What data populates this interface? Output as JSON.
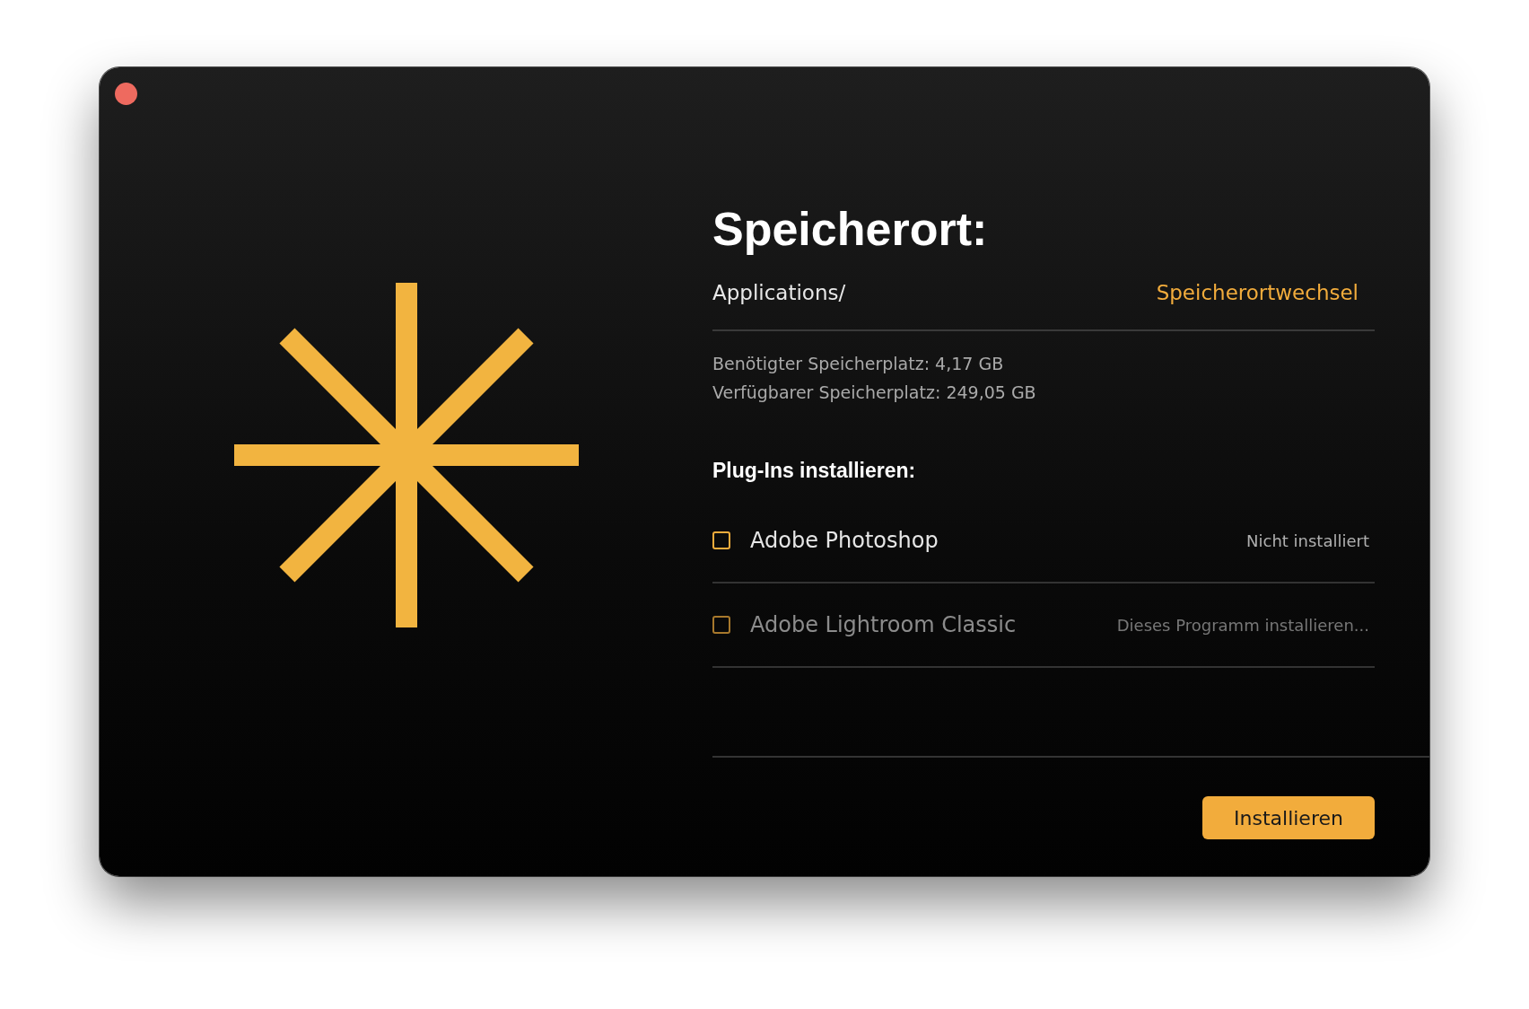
{
  "location": {
    "title": "Speicherort:",
    "path": "Applications/",
    "change_link": "Speicherortwechsel"
  },
  "storage": [
    "Benötigter Speicherplatz: 4,17 GB",
    "Verfügbarer Speicherplatz: 249,05 GB"
  ],
  "plugins": {
    "heading": "Plug-Ins installieren:",
    "items": [
      {
        "name": "Adobe Photoshop",
        "status": "Nicht installiert",
        "checked": false,
        "disabled": false
      },
      {
        "name": "Adobe Lightroom Classic",
        "status": "Dieses Programm installieren...",
        "checked": false,
        "disabled": true
      }
    ]
  },
  "install_button": "Installieren"
}
